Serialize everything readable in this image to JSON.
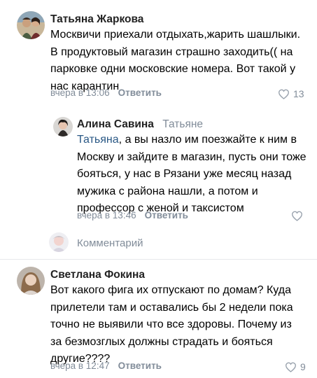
{
  "comments": [
    {
      "author": "Татьяна Жаркова",
      "text": "Москвичи приехали отдыхать,жарить шашлыки. В продуктовый магазин страшно заходить(( на парковке одни московские номера. Вот такой у нас карантин",
      "time": "вчера в 13:06",
      "reply_label": "Ответить",
      "likes": "13"
    },
    {
      "author": "Алина Савина",
      "reply_to": "Татьяне",
      "mention": "Татьяна",
      "text": ", а вы назло им поезжайте к ним в Москву и зайдите в магазин, пусть они тоже бояться, у нас в Рязани уже месяц назад мужика с района нашли, а потом и профессор с женой и таксистом",
      "time": "вчера в 13:46",
      "reply_label": "Ответить"
    },
    {
      "author": "Светлана Фокина",
      "text": "Вот какого фига их отпускают по домам? Куда прилетели там и оставались бы 2 недели пока точно не выявили что все здоровы. Почему из за безмозглых должны страдать и бояться другие????",
      "time": "вчера в 12:47",
      "reply_label": "Ответить",
      "likes": "9"
    }
  ],
  "comment_input": {
    "placeholder": "Комментарий"
  },
  "colors": {
    "secondary": "#818c99",
    "link": "#2a5885",
    "divider": "#e7e8ec"
  }
}
